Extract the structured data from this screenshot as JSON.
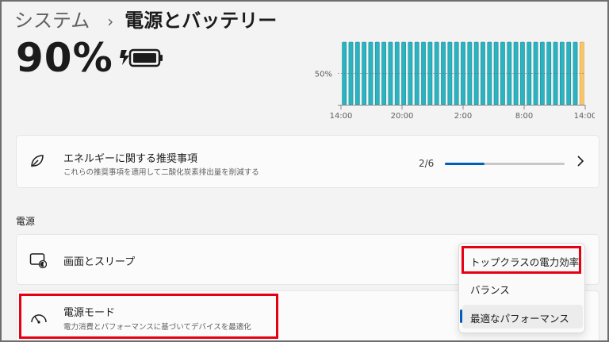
{
  "breadcrumb": {
    "parent": "システム",
    "separator": "›",
    "current": "電源とバッテリー"
  },
  "battery": {
    "percent_text": "90%",
    "icon": "battery-charging-icon",
    "level": 0.9
  },
  "chart_data": {
    "type": "bar",
    "ytick_label": "50%",
    "ytick_value": 50,
    "ylim": [
      0,
      100
    ],
    "xtick_labels": [
      "14:00",
      "20:00",
      "2:00",
      "8:00",
      "14:00"
    ],
    "values": [
      100,
      100,
      100,
      100,
      100,
      100,
      100,
      100,
      100,
      100,
      100,
      100,
      100,
      100,
      100,
      100,
      100,
      100,
      100,
      100,
      100,
      100,
      100,
      100,
      100,
      100,
      100,
      100,
      100,
      100,
      100,
      100,
      100,
      100,
      100,
      100,
      100
    ],
    "highlight_last": true,
    "colors": {
      "bar": "#2ab3c0",
      "bar_outline": "#1f8d98",
      "last_bar": "#f7c86b",
      "last_outline": "#d89b3a",
      "dash": "#6b6b6b"
    }
  },
  "recommendations": {
    "icon": "leaf-icon",
    "title": "エネルギーに関する推奨事項",
    "subtitle": "これらの推奨事項を適用して二酸化炭素排出量を削減する",
    "count": "2/6",
    "progress": 0.333
  },
  "power_section": {
    "heading": "電源"
  },
  "screen_sleep": {
    "icon": "screen-sleep-icon",
    "title": "画面とスリープ"
  },
  "power_mode": {
    "icon": "gauge-icon",
    "title": "電源モード",
    "subtitle": "電力消費とパフォーマンスに基づいてデバイスを最適化",
    "options": [
      "トップクラスの電力効率",
      "バランス",
      "最適なパフォーマンス"
    ],
    "selected_index": 2
  },
  "colors": {
    "accent": "#005fb8",
    "highlight_box": "#e60012"
  }
}
